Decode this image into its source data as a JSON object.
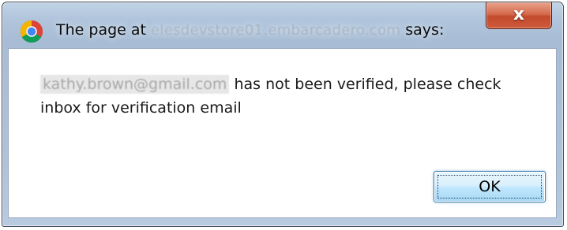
{
  "dialog": {
    "title_prefix": "The page at",
    "title_domain": "elesdevstore01.embarcadero.com",
    "title_suffix": "says:",
    "close_glyph": "x",
    "message": {
      "email": "kathy.brown@gmail.com",
      "text": "has not been verified, please check inbox for verification email"
    },
    "ok_label": "OK",
    "icon": "chrome-icon"
  },
  "colors": {
    "frame": "#aec2d8",
    "close_button": "#c34a2c",
    "ok_border": "#3c7fb1"
  }
}
